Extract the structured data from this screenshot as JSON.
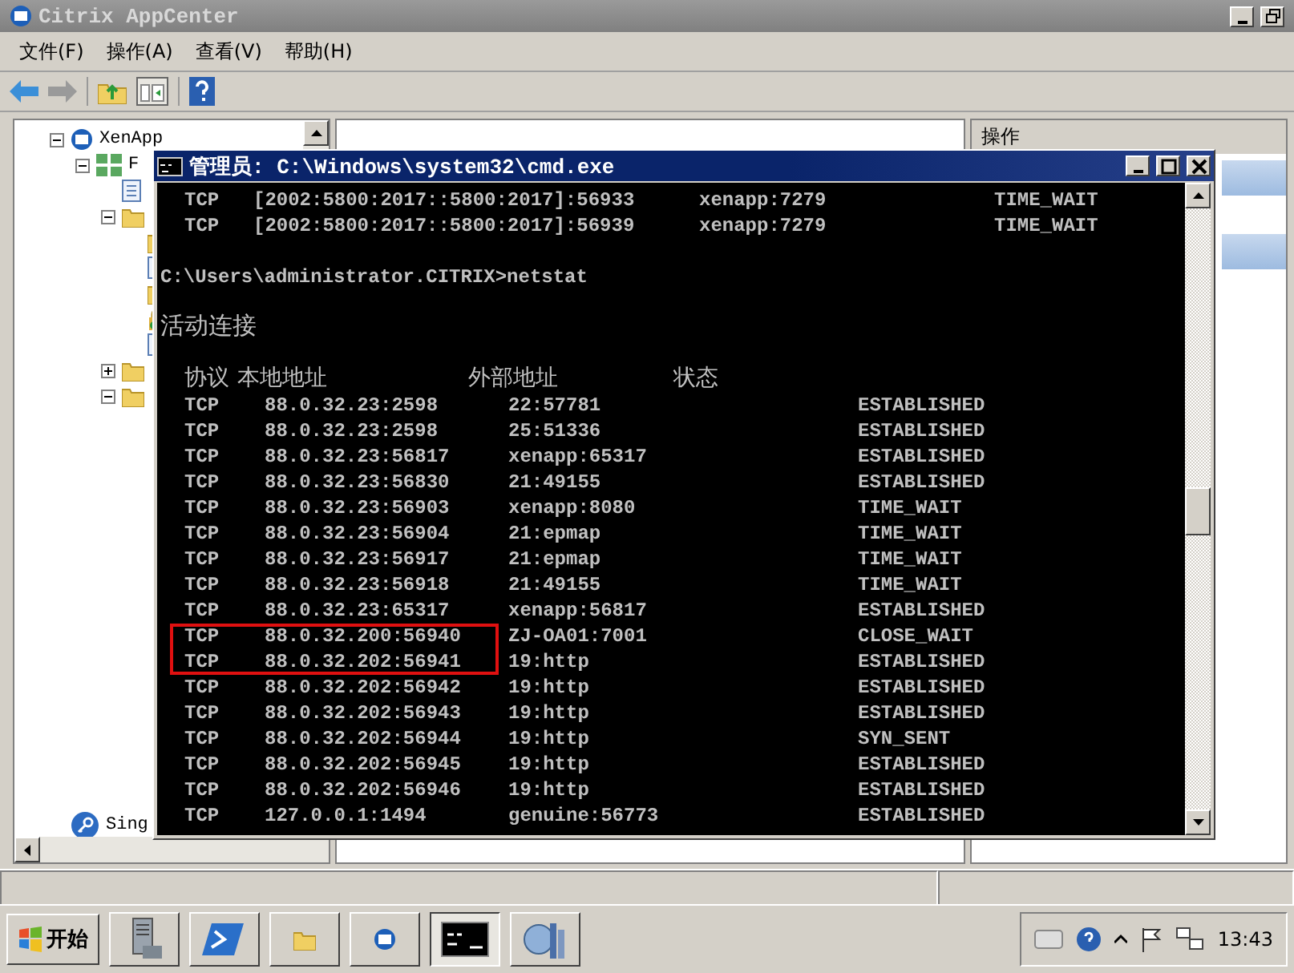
{
  "window": {
    "title": "Citrix AppCenter"
  },
  "menu": [
    "文件(F)",
    "操作(A)",
    "查看(V)",
    "帮助(H)"
  ],
  "tree": [
    {
      "label": "XenApp",
      "kind": "app",
      "expanded": true,
      "children": [
        {
          "label": "F",
          "kind": "farm",
          "expanded": true,
          "children": [
            {
              "kind": "doc"
            },
            {
              "kind": "folder",
              "expanded": true,
              "children": [
                {
                  "kind": "folder"
                },
                {
                  "kind": "doc"
                },
                {
                  "kind": "folder"
                },
                {
                  "kind": "lock"
                },
                {
                  "kind": "doc"
                }
              ]
            },
            {
              "kind": "folder",
              "expanded": false
            },
            {
              "kind": "folder",
              "expanded": true
            }
          ]
        }
      ]
    },
    {
      "label": "Sing",
      "kind": "key"
    }
  ],
  "actions": {
    "title": "操作"
  },
  "cmd": {
    "title": "管理员: C:\\Windows\\system32\\cmd.exe",
    "lines": [
      {
        "kind": "ipv6",
        "cells": [
          "TCP",
          "[2002:5800:2017::5800:2017]:56933",
          "xenapp:7279",
          "TIME_WAIT"
        ]
      },
      {
        "kind": "ipv6",
        "cells": [
          "TCP",
          "[2002:5800:2017::5800:2017]:56939",
          "xenapp:7279",
          "TIME_WAIT"
        ]
      },
      {
        "kind": "blank"
      },
      {
        "kind": "text",
        "text": "C:\\Users\\administrator.CITRIX>netstat"
      },
      {
        "kind": "blank"
      },
      {
        "kind": "heading",
        "text": "活动连接"
      },
      {
        "kind": "blank"
      },
      {
        "kind": "header",
        "cells": [
          "协议",
          "本地地址",
          "外部地址",
          "状态"
        ]
      },
      {
        "kind": "conn",
        "highlighted": false,
        "cells": [
          "TCP",
          "88.0.32.23:2598",
          "22:57781",
          "ESTABLISHED"
        ]
      },
      {
        "kind": "conn",
        "highlighted": false,
        "cells": [
          "TCP",
          "88.0.32.23:2598",
          "25:51336",
          "ESTABLISHED"
        ]
      },
      {
        "kind": "conn",
        "highlighted": false,
        "cells": [
          "TCP",
          "88.0.32.23:56817",
          "xenapp:65317",
          "ESTABLISHED"
        ]
      },
      {
        "kind": "conn",
        "highlighted": false,
        "cells": [
          "TCP",
          "88.0.32.23:56830",
          "21:49155",
          "ESTABLISHED"
        ]
      },
      {
        "kind": "conn",
        "highlighted": false,
        "cells": [
          "TCP",
          "88.0.32.23:56903",
          "xenapp:8080",
          "TIME_WAIT"
        ]
      },
      {
        "kind": "conn",
        "highlighted": false,
        "cells": [
          "TCP",
          "88.0.32.23:56904",
          "21:epmap",
          "TIME_WAIT"
        ]
      },
      {
        "kind": "conn",
        "highlighted": false,
        "cells": [
          "TCP",
          "88.0.32.23:56917",
          "21:epmap",
          "TIME_WAIT"
        ]
      },
      {
        "kind": "conn",
        "highlighted": false,
        "cells": [
          "TCP",
          "88.0.32.23:56918",
          "21:49155",
          "TIME_WAIT"
        ]
      },
      {
        "kind": "conn",
        "highlighted": false,
        "cells": [
          "TCP",
          "88.0.32.23:65317",
          "xenapp:56817",
          "ESTABLISHED"
        ]
      },
      {
        "kind": "conn",
        "highlighted": true,
        "cells": [
          "TCP",
          "88.0.32.200:56940",
          "ZJ-OA01:7001",
          "CLOSE_WAIT"
        ]
      },
      {
        "kind": "conn",
        "highlighted": true,
        "cells": [
          "TCP",
          "88.0.32.202:56941",
          "19:http",
          "ESTABLISHED"
        ]
      },
      {
        "kind": "conn",
        "highlighted": false,
        "cells": [
          "TCP",
          "88.0.32.202:56942",
          "19:http",
          "ESTABLISHED"
        ]
      },
      {
        "kind": "conn",
        "highlighted": false,
        "cells": [
          "TCP",
          "88.0.32.202:56943",
          "19:http",
          "ESTABLISHED"
        ]
      },
      {
        "kind": "conn",
        "highlighted": false,
        "cells": [
          "TCP",
          "88.0.32.202:56944",
          "19:http",
          "SYN_SENT"
        ]
      },
      {
        "kind": "conn",
        "highlighted": false,
        "cells": [
          "TCP",
          "88.0.32.202:56945",
          "19:http",
          "ESTABLISHED"
        ]
      },
      {
        "kind": "conn",
        "highlighted": false,
        "cells": [
          "TCP",
          "88.0.32.202:56946",
          "19:http",
          "ESTABLISHED"
        ]
      },
      {
        "kind": "conn",
        "highlighted": false,
        "cells": [
          "TCP",
          "127.0.0.1:1494",
          "genuine:56773",
          "ESTABLISHED"
        ]
      }
    ]
  },
  "taskbar": {
    "start": "开始",
    "buttons": [
      {
        "kind": "server",
        "selected": false
      },
      {
        "kind": "shell",
        "selected": false
      },
      {
        "kind": "folder",
        "selected": false
      },
      {
        "kind": "app",
        "selected": false
      },
      {
        "kind": "console",
        "selected": true
      },
      {
        "kind": "network",
        "selected": false
      }
    ],
    "clock": "13:43"
  }
}
